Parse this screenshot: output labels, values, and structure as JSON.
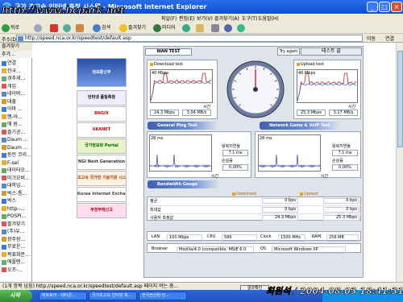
{
  "window": {
    "title": "국가 초고속 인터넷 측정 시스템 - Microsoft Internet Explorer",
    "watermark": "http://www.bcpark.net"
  },
  "menubar": {
    "items": [
      "파일(F)",
      "편집(E)",
      "보기(V)",
      "즐겨찾기(A)",
      "도구(T)",
      "도움말(H)"
    ]
  },
  "toolbar": {
    "back": "뒤로",
    "search": "검색",
    "favorites": "즐겨찾기",
    "media": "미디어"
  },
  "address": {
    "label": "주소(D)",
    "url": "http://speed.nca.or.kr/speedtest/default.asp",
    "go": "이동",
    "links": "연결"
  },
  "favorites": {
    "title": "즐겨찾기",
    "add": "추가...",
    "items": [
      "연결",
      "한국...",
      "경추세...",
      "게임",
      "네이버...",
      "대출",
      "아마 ...",
      "행-아...",
      "애 원...",
      "즐기공...",
      "Daum ...",
      "Daum ...",
      "동인 코리...",
      "F-sel",
      "데이터오...",
      "마크모비...",
      "대학입...",
      "벅스-통...",
      "벅스",
      "http--...",
      "POSPI...",
      "즐겨찾기",
      "(주)유...",
      "광주장...",
      "무료운...",
      "목표화문...",
      "에플텐...",
      "오프-..."
    ]
  },
  "banners": [
    "정보통신부",
    "인터넷 품질측정",
    "BNGIX",
    "6KANET",
    "국가정보화 Portal",
    "NGI Next Generation",
    "초고속 국가망 기술지원 시스템",
    "Korea Internet Exchange",
    "부정부패신고"
  ],
  "speedtest": {
    "tab": "WAN TEST",
    "try_again": "Try again",
    "test_end": "테스트 끝",
    "download": {
      "title": "Download test",
      "axis_top": "40 Mbps",
      "time_label": "시간",
      "left_value": "24.3 Mbps",
      "right_value": "3.04 MB/s"
    },
    "upload": {
      "title": "Upload test",
      "axis_top": "40 Mbps",
      "time_label": "시간",
      "left_value": "25.3 Mbps",
      "right_value": "3.17 MB/s"
    },
    "ping": {
      "title": "General Ping Test",
      "axis_top": "28 ms",
      "avg_label": "왕복지연율",
      "avg_value": "7.1 ms",
      "loss_label": "손실률",
      "loss_value": "0.00%",
      "time_label": "시간"
    },
    "voip": {
      "title": "Network Game & VoIP Test",
      "axis_top": "28 ms",
      "avg_label": "왕복지연율",
      "avg_value": "7.1 ms",
      "loss_label": "손실률",
      "loss_value": "0.00%",
      "time_label": "시간"
    },
    "bandwidth": {
      "title": "Bandwidth Gauge",
      "col_download": "Download",
      "col_upload": "Upload",
      "rows": [
        {
          "label": "평균",
          "download": "0 bps",
          "upload": "0 bps"
        },
        {
          "label": "최대값",
          "download": "0 bps",
          "upload": "0 bps"
        },
        {
          "label": "사용자 측정값",
          "download": "24.3 Mbps",
          "upload": "25.3 Mbps"
        }
      ]
    },
    "system": {
      "lan_label": "LAN",
      "lan_value": "100 Mbps",
      "cpu_label": "CPU",
      "cpu_value": "586",
      "clock_label": "Clock",
      "clock_value": "1500 MHz",
      "ram_label": "RAM",
      "ram_value": "256 MB",
      "browser_label": "Browser",
      "browser_value": "Mozilla/4.0 (compatible; MSIE 6.0",
      "os_label": "OS",
      "os_value": "Microsoft Windows XP"
    },
    "confirm_button": "결과확인"
  },
  "statusbar": {
    "text": "(1개 항목 남음) http://speed.nca.or.kr/speedtest/default.asp 페이지 여는 중..."
  },
  "taskbar": {
    "start": "시작",
    "tasks": [
      "비트토크 - 네티즌...",
      "국가초고속 인터넷 측...",
      "한국전산원-인..."
    ],
    "clock_overlay": "최원석 / 2004-08-03 18:41:31"
  },
  "colors": {
    "accent": "#3f5fb0",
    "download_line": "#c0202a",
    "upload_line": "#c0202a",
    "ping_line": "#3040b0"
  }
}
